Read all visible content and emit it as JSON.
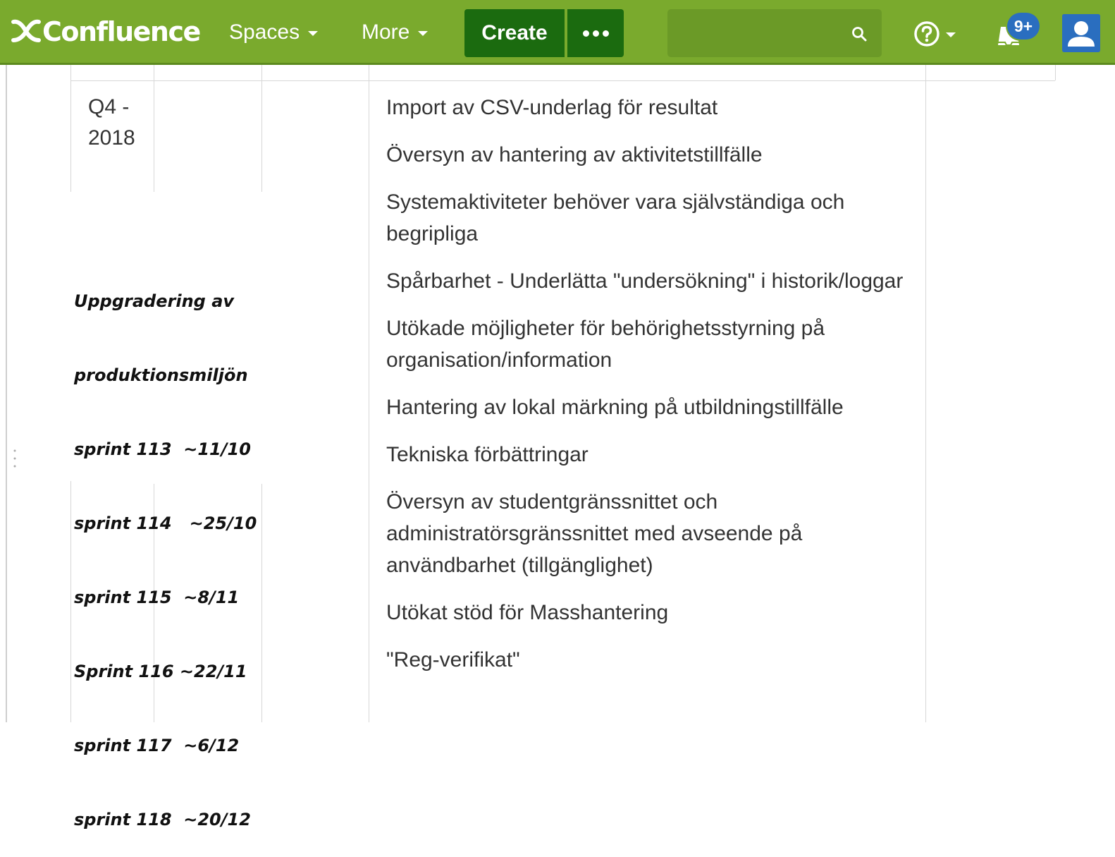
{
  "header": {
    "logo_text": "Confluence",
    "nav": {
      "spaces_label": "Spaces",
      "more_label": "More"
    },
    "create_label": "Create",
    "more_actions_icon": "ellipsis-icon",
    "search": {
      "placeholder": "",
      "icon": "search-icon"
    },
    "help_icon": "question-circle-icon",
    "notifications": {
      "icon": "workbox-icon",
      "badge": "9+"
    },
    "avatar_icon": "user-avatar-icon",
    "colors": {
      "bar": "#7aaa2d",
      "create_button": "#1b6b0f",
      "badge": "#2a6ebf"
    }
  },
  "content": {
    "quarter_label": {
      "line1": "Q4 -",
      "line2": "2018"
    },
    "sprint_note": [
      "Uppgradering av",
      "produktionsmiljön",
      "sprint 113  ~11/10",
      "sprint 114   ~25/10",
      "sprint 115  ~8/11",
      "Sprint 116 ~22/11",
      "sprint 117  ~6/12",
      "sprint 118  ~20/12"
    ],
    "items": [
      "Import av CSV-underlag för resultat",
      "Översyn av hantering av aktivitetstillfälle",
      "Systemaktiviteter behöver vara självständiga och begripliga",
      "Spårbarhet - Underlätta \"undersökning\" i historik/loggar",
      "Utökade möjligheter för behörighetsstyrning på organisation/information",
      "Hantering av lokal märkning på utbildningstillfälle",
      "Tekniska förbättringar",
      "Översyn av studentgränssnittet och administratörsgränssnittet med avseende på användbarhet (tillgänglighet)",
      "Utökat stöd för Masshantering",
      "\"Reg-verifikat\""
    ]
  }
}
